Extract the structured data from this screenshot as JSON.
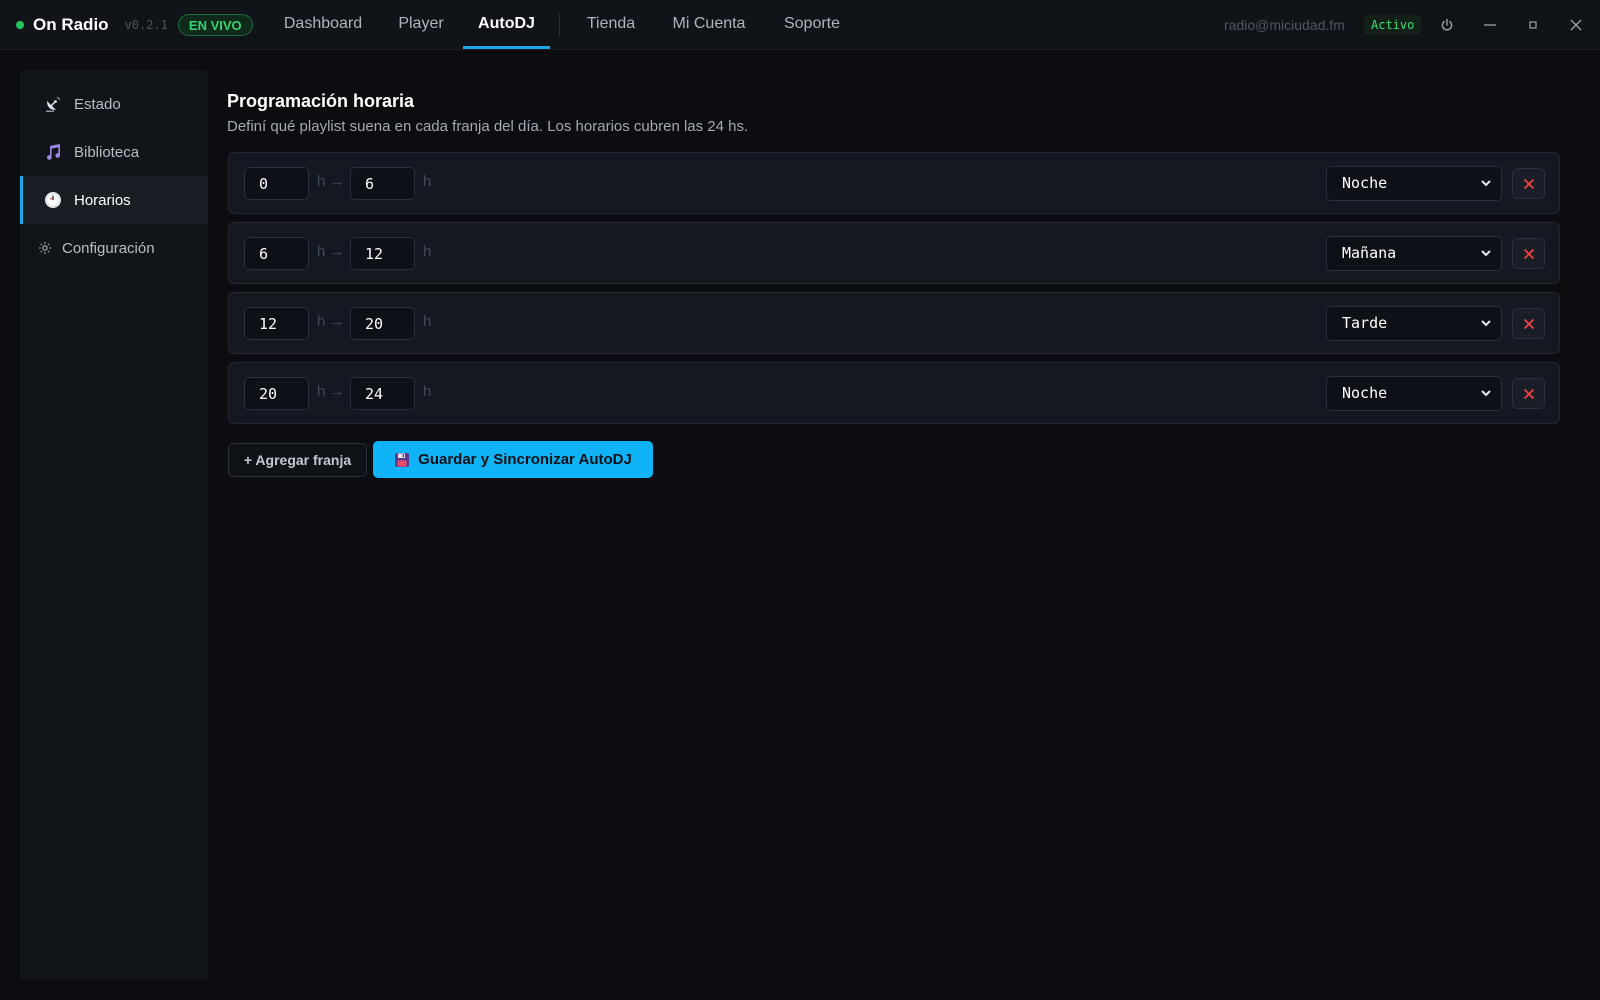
{
  "app": {
    "name": "On Radio",
    "version": "v0.2.1",
    "live_badge": "EN VIVO",
    "account_email": "radio@miciudad.fm",
    "account_status": "Activo"
  },
  "nav": {
    "tabs": [
      {
        "label": "Dashboard"
      },
      {
        "label": "Player"
      },
      {
        "label": "AutoDJ",
        "active": true
      },
      {
        "label": "Tienda"
      },
      {
        "label": "Mi Cuenta"
      },
      {
        "label": "Soporte"
      }
    ]
  },
  "sidebar": {
    "items": [
      {
        "label": "Estado",
        "icon": "satellite-dish-icon"
      },
      {
        "label": "Biblioteca",
        "icon": "music-note-icon"
      },
      {
        "label": "Horarios",
        "icon": "clock-icon",
        "active": true
      },
      {
        "label": "Configuración",
        "icon": "gear-icon"
      }
    ]
  },
  "schedule": {
    "title": "Programación horaria",
    "subtitle": "Definí qué playlist suena en cada franja del día. Los horarios cubren las 24 hs.",
    "unit": "h",
    "arrow": "→",
    "slots": [
      {
        "from": "0",
        "to": "6",
        "playlist": "Noche"
      },
      {
        "from": "6",
        "to": "12",
        "playlist": "Mañana"
      },
      {
        "from": "12",
        "to": "20",
        "playlist": "Tarde"
      },
      {
        "from": "20",
        "to": "24",
        "playlist": "Noche"
      }
    ],
    "add_label": "+  Agregar franja",
    "save_label": "Guardar y Sincronizar AutoDJ"
  },
  "colors": {
    "accent": "#10b3f5",
    "live": "#22c55e",
    "danger": "#ef4444",
    "background": "#0b0d11"
  }
}
